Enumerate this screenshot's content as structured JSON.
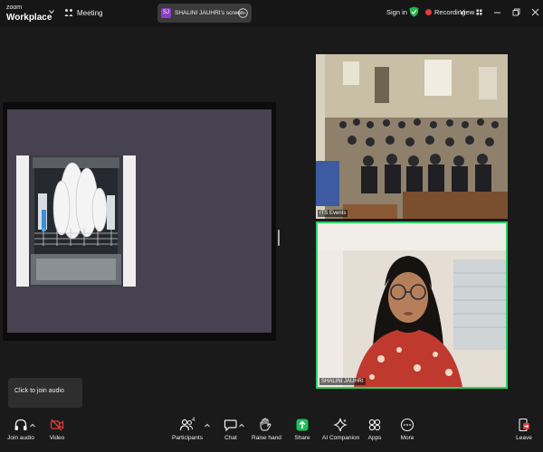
{
  "app": {
    "brand_line1": "zoom",
    "brand_line2": "Workplace"
  },
  "topbar": {
    "meeting_label": "Meeting",
    "share_pill": {
      "avatar_initials": "SJ",
      "label": "SHALINI JAUHRI's screen"
    },
    "sign_in": "Sign in",
    "recording": "Recording",
    "view": "View"
  },
  "tiles": [
    {
      "name": "ITS Events"
    },
    {
      "name": "SHALINI JAUHRI"
    }
  ],
  "tooltip": {
    "text": "Click to join audio"
  },
  "toolbar": {
    "join_audio": "Join audio",
    "video": "Video",
    "participants": "Participants",
    "participants_count": "4",
    "chat": "Chat",
    "raise_hand": "Raise hand",
    "share": "Share",
    "ai_companion": "AI Companion",
    "apps": "Apps",
    "more": "More",
    "leave": "Leave"
  },
  "colors": {
    "accent_green": "#25d366",
    "record_red": "#e03c3c",
    "share_green": "#1fbf5a",
    "canvas": "#464252"
  }
}
